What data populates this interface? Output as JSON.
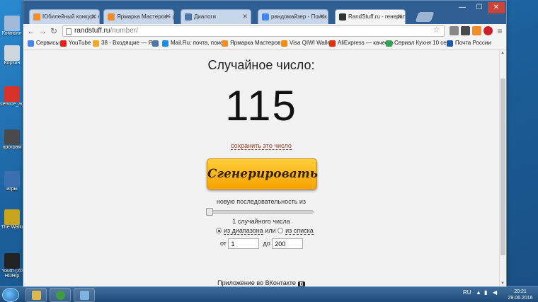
{
  "desktop": {
    "icons": [
      {
        "label": "Компьют",
        "color": "#9fb9d6"
      },
      {
        "label": "Корзин",
        "color": "#cfd6de"
      },
      {
        "label": "service_ag",
        "color": "#d9322b"
      },
      {
        "label": "програм",
        "color": "#4a4a4a"
      },
      {
        "label": "игры",
        "color": "#3b6fb0"
      },
      {
        "label": "The Walki",
        "color": "#c7a41b"
      },
      {
        "label": "Youth (20",
        "color": "#222222"
      },
      {
        "label": "HDRip",
        "color": "#222222"
      }
    ]
  },
  "browser": {
    "tabs": [
      {
        "label": "Юбилейный конкурс ко",
        "color": "#f28c28"
      },
      {
        "label": "Ярмарка Мастеров - руч",
        "color": "#f28c28"
      },
      {
        "label": "Диалоги",
        "color": "#4a76a8"
      },
      {
        "label": "рандомайзер - Поиск в",
        "color": "#4285f4"
      },
      {
        "label": "RandStuff.ru - генератор",
        "color": "#333333"
      }
    ],
    "url_host": "randstuff.ru",
    "url_path": "/number/",
    "bookmarks": [
      {
        "label": "Сервисы",
        "color": "#4285f4"
      },
      {
        "label": "YouTube",
        "color": "#e62117"
      },
      {
        "label": "38 - Входящие — Янд",
        "color": "#f5a623"
      },
      {
        "label": "",
        "color": "#4a76a8"
      },
      {
        "label": "Mail.Ru: почта, поиск",
        "color": "#168de2"
      },
      {
        "label": "Ярмарка Мастеров",
        "color": "#f28c28"
      },
      {
        "label": "Visa QIWI Wallet",
        "color": "#ff8c00"
      },
      {
        "label": "AliExpress — качеств",
        "color": "#e62e04"
      },
      {
        "label": "Сериал Кухня 10 сер",
        "color": "#2da44e"
      },
      {
        "label": "Почта России",
        "color": "#1a5aa8"
      }
    ],
    "close": "✕",
    "minimize": "—",
    "maximize": "☐"
  },
  "page": {
    "heading": "Случайное число:",
    "number": "115",
    "save_link": "сохранить это число",
    "generate_button": "Сгенерировать",
    "sequence_label": "новую последовательность из",
    "sequence_count": 1,
    "count_label": "1 случайного числа",
    "mode_range": "из диапазона",
    "mode_or": "или",
    "mode_list": "из списка",
    "from_label": "от",
    "from_value": "1",
    "to_label": "до",
    "to_value": "200",
    "vk_link": "Приложение во ВКонтакте",
    "vk_badge": "В"
  },
  "taskbar": {
    "lang": "RU",
    "time": "20:21",
    "date": "29.06.2016"
  }
}
